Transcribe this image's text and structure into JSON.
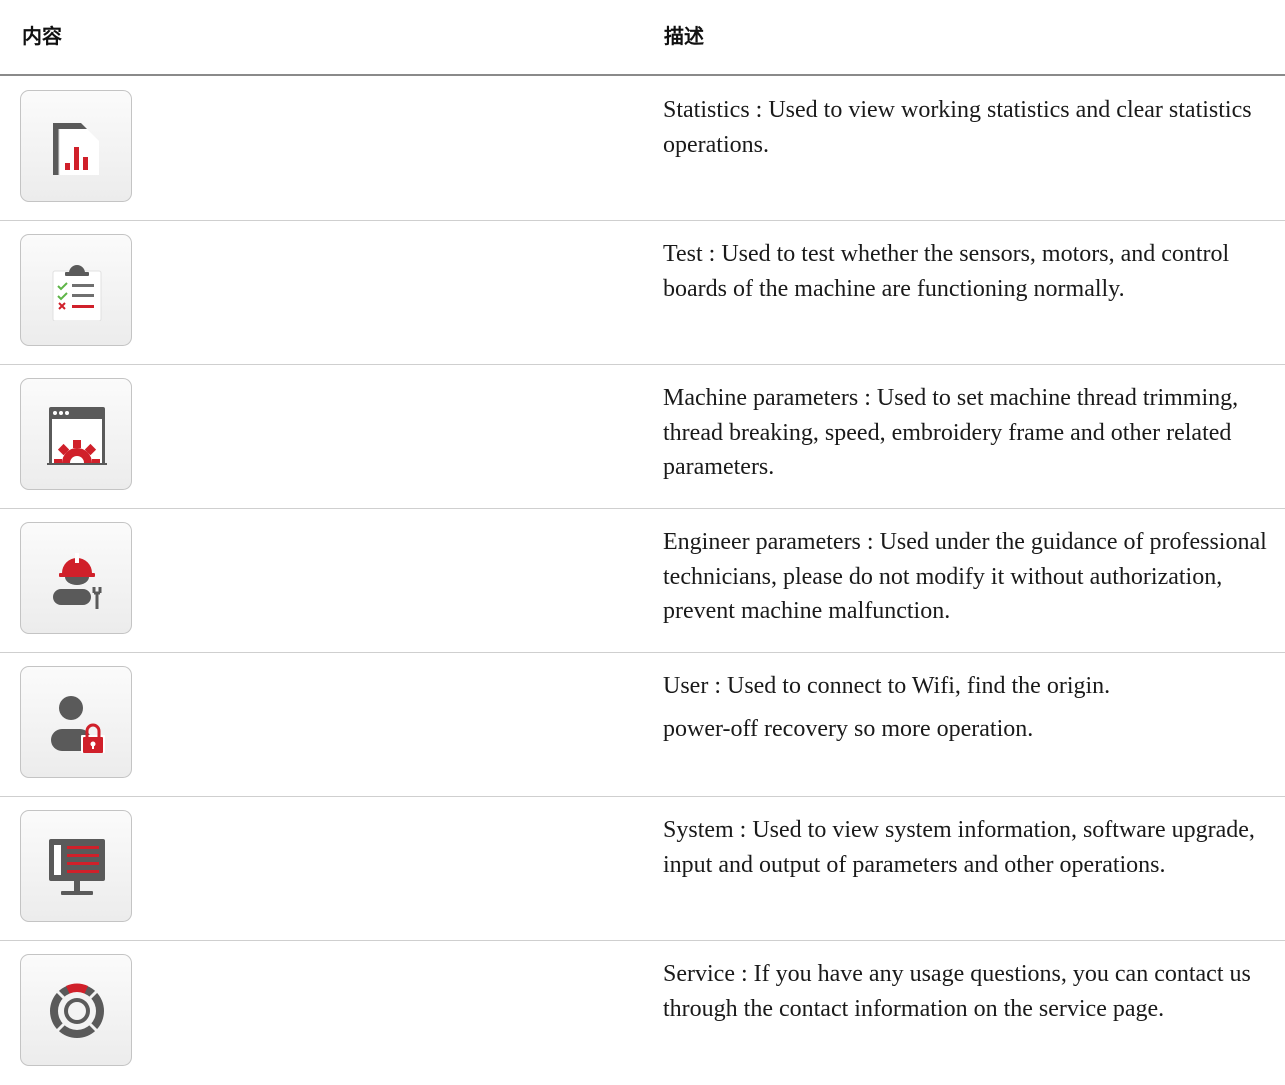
{
  "header": {
    "content": "内容",
    "description": "描述"
  },
  "colors": {
    "accent_red": "#d0202a",
    "icon_gray": "#5a5a5a"
  },
  "rows": [
    {
      "icon": "statistics-chart-icon",
      "desc": "Statistics : Used to view working statistics and clear statistics operations."
    },
    {
      "icon": "test-clipboard-icon",
      "desc": "Test : Used to test whether the sensors, motors, and control boards of the machine are functioning normally."
    },
    {
      "icon": "machine-parameters-gear-icon",
      "desc": "Machine parameters : Used to set machine thread trimming, thread breaking, speed, embroidery frame and other related parameters."
    },
    {
      "icon": "engineer-parameters-icon",
      "desc": "Engineer parameters : Used under the guidance of professional technicians, please do not modify it without authorization, prevent machine malfunction."
    },
    {
      "icon": "user-lock-icon",
      "desc": "User : Used to connect to Wifi, find the origin.",
      "desc2": "power-off recovery  so more operation."
    },
    {
      "icon": "system-monitor-icon",
      "desc": "System : Used to view system information, software upgrade, input and output of parameters and other operations."
    },
    {
      "icon": "service-lifebuoy-icon",
      "desc": "Service : If you have any usage questions, you can contact us through the contact information on the service page."
    }
  ]
}
